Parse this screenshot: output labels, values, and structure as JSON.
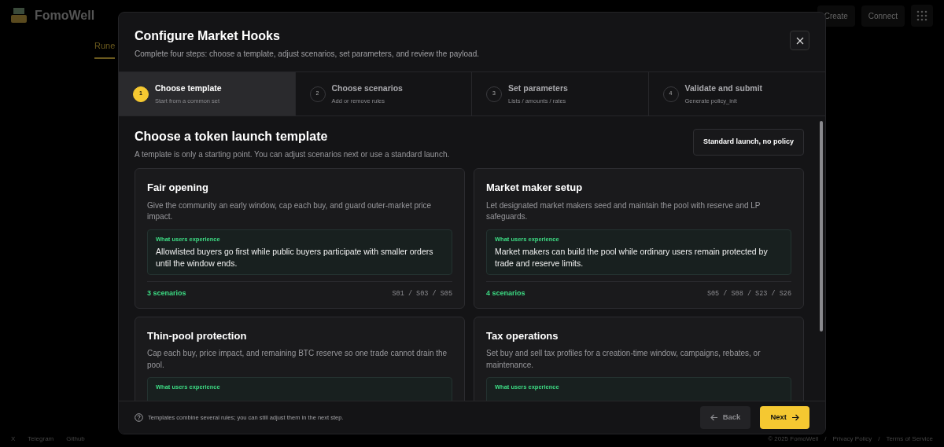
{
  "app": {
    "brand": "FomoWell",
    "nav_tab": "Rune",
    "actions": [
      "Create",
      "Connect"
    ],
    "footer_links": [
      "X",
      "Telegram",
      "Github"
    ],
    "footer_right": [
      "© 2025 FomoWell",
      "/",
      "Privacy Policy",
      "/",
      "Terms of Service"
    ]
  },
  "modal": {
    "title": "Configure Market Hooks",
    "subtitle": "Complete four steps: choose a template, adjust scenarios, set parameters, and review the payload.",
    "steps": [
      {
        "number": "1",
        "title": "Choose template",
        "subtitle": "Start from a common set",
        "selected": true
      },
      {
        "number": "2",
        "title": "Choose scenarios",
        "subtitle": "Add or remove rules",
        "selected": false
      },
      {
        "number": "3",
        "title": "Set parameters",
        "subtitle": "Lists / amounts / rates",
        "selected": false
      },
      {
        "number": "4",
        "title": "Validate and submit",
        "subtitle": "Generate policy_init",
        "selected": false
      }
    ],
    "section_title": "Choose a token launch template",
    "section_subtitle": "A template is only a starting point. You can adjust scenarios next or use a standard launch.",
    "standard_button": "Standard launch, no policy",
    "templates": [
      {
        "title": "Fair opening",
        "description": "Give the community an early window, cap each buy, and guard outer-market price impact.",
        "experience_label": "What users experience",
        "experience": "Allowlisted buyers go first while public buyers participate with smaller orders until the window ends.",
        "count": "3 scenarios",
        "codes": "S01 / S03 / S05"
      },
      {
        "title": "Market maker setup",
        "description": "Let designated market makers seed and maintain the pool with reserve and LP safeguards.",
        "experience_label": "What users experience",
        "experience": "Market makers can build the pool while ordinary users remain protected by trade and reserve limits.",
        "count": "4 scenarios",
        "codes": "S05 / S08 / S23 / S26"
      },
      {
        "title": "Thin-pool protection",
        "description": "Cap each buy, price impact, and remaining BTC reserve so one trade cannot drain the pool.",
        "experience_label": "What users experience"
      },
      {
        "title": "Tax operations",
        "description": "Set buy and sell tax profiles for a creation-time window, campaigns, rebates, or maintenance.",
        "experience_label": "What users experience"
      }
    ],
    "footer_note": "Templates combine several rules; you can still adjust them in the next step.",
    "back_button": "Back",
    "next_button": "Next"
  }
}
